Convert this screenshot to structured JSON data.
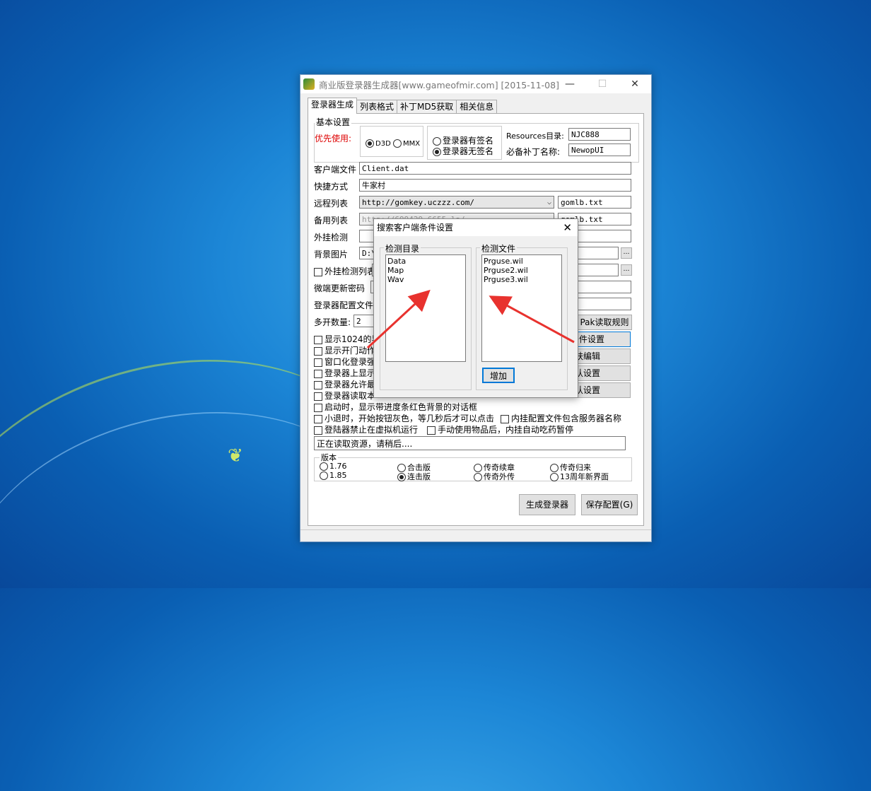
{
  "window": {
    "title": "商业版登录器生成器[www.gameofmir.com] [2015-11-08]",
    "tabs": [
      "登录器生成",
      "列表格式",
      "补丁MD5获取",
      "相关信息"
    ]
  },
  "basic": {
    "group_label": "基本设置",
    "priority_label": "优先使用:",
    "render_options": [
      "D3D",
      "MMX"
    ],
    "sign_options": [
      "登录器有签名",
      "登录器无签名"
    ],
    "resources_label": "Resources目录:",
    "resources_value": "NJC888",
    "patch_label": "必备补丁名称:",
    "patch_value": "NewopUI"
  },
  "form": {
    "client_label": "客户端文件",
    "client_value": "Client.dat",
    "shortcut_label": "快捷方式",
    "shortcut_value": "牛家村",
    "remote_label": "远程列表",
    "remote_value": "http://gomkey.uczzz.com/",
    "remote_file": "gomlb.txt",
    "backup_label": "备用列表",
    "backup_value": "http://699429.6655.la/",
    "backup_file": "gomlb.txt",
    "plugin_label": "外挂检测",
    "bg_label": "背景图片",
    "bg_value": "D:\\",
    "plugin_list_label": "外挂检测列表",
    "micro_pwd_label": "微端更新密码",
    "config_label": "登录器配置文件",
    "multi_label": "多开数量:",
    "multi_value": "2",
    "pak_button": "Pak读取规则",
    "client_cond_button": "端条件设置",
    "skin_button": "皮肤编辑",
    "default_button1": "默认设置",
    "default_button2": "默认设置"
  },
  "checks": [
    "显示1024的界",
    "显示开门动作",
    "窗口化登录强",
    "登录器上显示",
    "登录器允许最",
    "登录器读取本",
    "启动时，显示带进度条红色背景的对话框",
    "小退时，开始按钮灰色，等几秒后才可以点击",
    "内挂配置文件包含服务器名称",
    "登陆器禁止在虚拟机运行",
    "手动使用物品后，内挂自动吃药暂停"
  ],
  "status_text": "正在读取资源，请稍后....",
  "version": {
    "label": "版本",
    "options": [
      "1.76",
      "合击版",
      "传奇续章",
      "传奇归来",
      "1.85",
      "连击版",
      "传奇外传",
      "13周年新界面"
    ]
  },
  "buttons": {
    "generate": "生成登录器",
    "save": "保存配置(G)"
  },
  "dialog": {
    "title": "搜索客户端条件设置",
    "dir_label": "检测目录",
    "dirs": [
      "Data",
      "Map",
      "Wav"
    ],
    "file_label": "检测文件",
    "files": [
      "Prguse.wil",
      "Prguse2.wil",
      "Prguse3.wil"
    ],
    "add_button": "增加"
  },
  "colors": {
    "accent_red": "#e8322e",
    "desktop_blue": "#1c86d6"
  }
}
